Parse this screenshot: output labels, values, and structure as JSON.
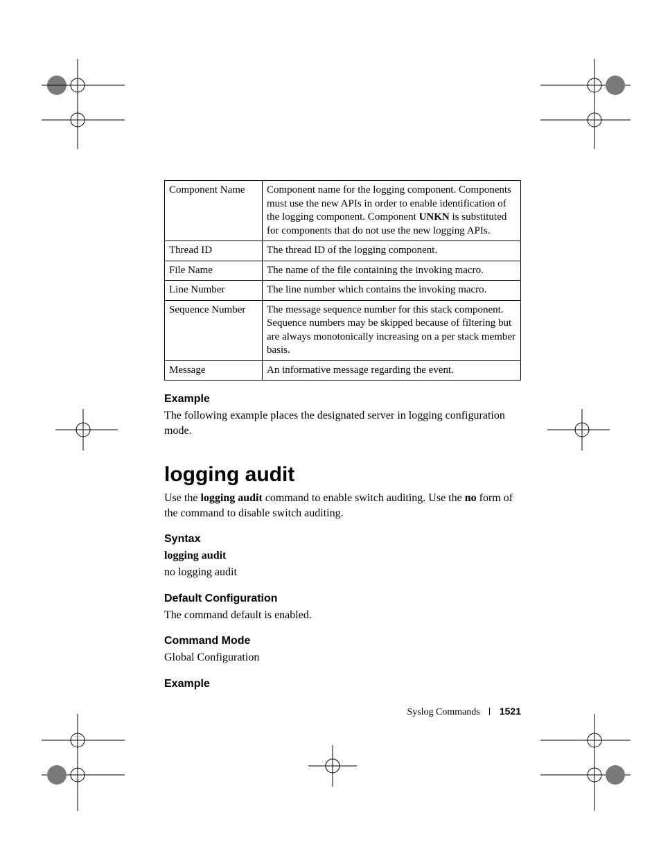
{
  "table": {
    "rows": [
      {
        "k": "Component Name",
        "v_parts": [
          "Component name for the logging component. Components must use the new APIs in order to enable identification of the logging component. Component ",
          "UNKN",
          " is substituted for components that do not use the new logging APIs."
        ]
      },
      {
        "k": "Thread ID",
        "v": "The thread ID of the logging component."
      },
      {
        "k": "File Name",
        "v": "The name of the file containing the invoking macro."
      },
      {
        "k": "Line Number",
        "v": "The line number which contains the invoking macro."
      },
      {
        "k": "Sequence Number",
        "v": "The message sequence number for this stack component. Sequence numbers may be skipped because of filtering but are always monotonically increasing on a per stack member basis."
      },
      {
        "k": "Message",
        "v": "An informative message regarding the event."
      }
    ]
  },
  "s1": {
    "heading": "Example",
    "body": "The following example places the designated server in logging configuration mode."
  },
  "cmd": {
    "title": "logging audit",
    "desc_parts": [
      "Use the ",
      "logging audit",
      " command to enable switch auditing. Use the ",
      "no",
      " form of the command to disable switch auditing."
    ]
  },
  "syntax": {
    "heading": "Syntax",
    "line1": "logging audit",
    "line2": "no logging audit"
  },
  "defcfg": {
    "heading": "Default Configuration",
    "body": "The command default is enabled."
  },
  "mode": {
    "heading": "Command Mode",
    "body": "Global Configuration"
  },
  "ex2": {
    "heading": "Example"
  },
  "footer": {
    "section": "Syslog Commands",
    "page": "1521"
  }
}
